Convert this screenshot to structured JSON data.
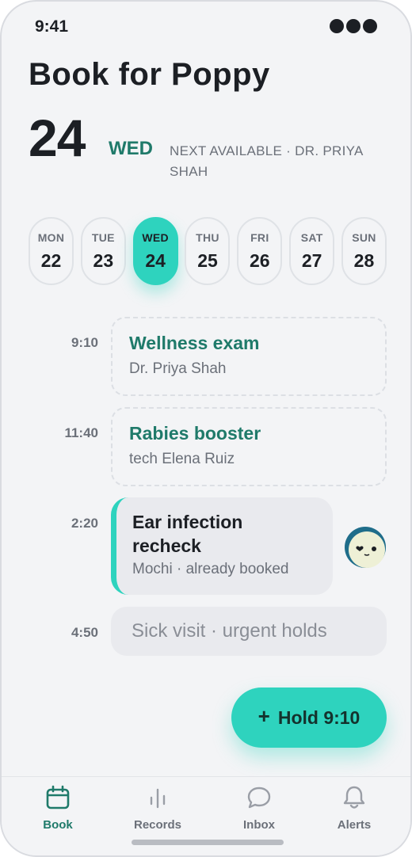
{
  "status_bar": {
    "time": "9:41"
  },
  "header": {
    "title": "Book for Poppy",
    "date_number": "24",
    "date_weekday": "WED",
    "next_available": "NEXT AVAILABLE · DR. PRIYA SHAH"
  },
  "week": [
    {
      "day": "MON",
      "date": "22",
      "selected": false
    },
    {
      "day": "TUE",
      "date": "23",
      "selected": false
    },
    {
      "day": "WED",
      "date": "24",
      "selected": true
    },
    {
      "day": "THU",
      "date": "25",
      "selected": false
    },
    {
      "day": "FRI",
      "date": "26",
      "selected": false
    },
    {
      "day": "SAT",
      "date": "27",
      "selected": false
    },
    {
      "day": "SUN",
      "date": "28",
      "selected": false
    }
  ],
  "slots": [
    {
      "time": "9:10",
      "title": "Wellness exam",
      "subtitle": "Dr. Priya Shah",
      "status": "open"
    },
    {
      "time": "11:40",
      "title": "Rabies booster",
      "subtitle": "tech Elena Ruiz",
      "status": "open"
    },
    {
      "time": "2:20",
      "title": "Ear infection recheck",
      "subtitle": "Mochi · already booked",
      "status": "booked"
    },
    {
      "time": "4:50",
      "title": "Sick visit · urgent holds",
      "subtitle": "",
      "status": "urgent"
    }
  ],
  "fab": {
    "plus": "+",
    "label": "Hold 9:10"
  },
  "tabs": [
    {
      "label": "Book",
      "icon": "calendar-icon",
      "active": true
    },
    {
      "label": "Records",
      "icon": "bar-chart-icon",
      "active": false
    },
    {
      "label": "Inbox",
      "icon": "chat-bubble-icon",
      "active": false
    },
    {
      "label": "Alerts",
      "icon": "bell-icon",
      "active": false
    }
  ],
  "colors": {
    "accent": "#2ed3be",
    "accent_dark": "#1f7a6a",
    "background": "#f3f4f6",
    "text": "#1c1f24",
    "muted": "#6b7079"
  }
}
